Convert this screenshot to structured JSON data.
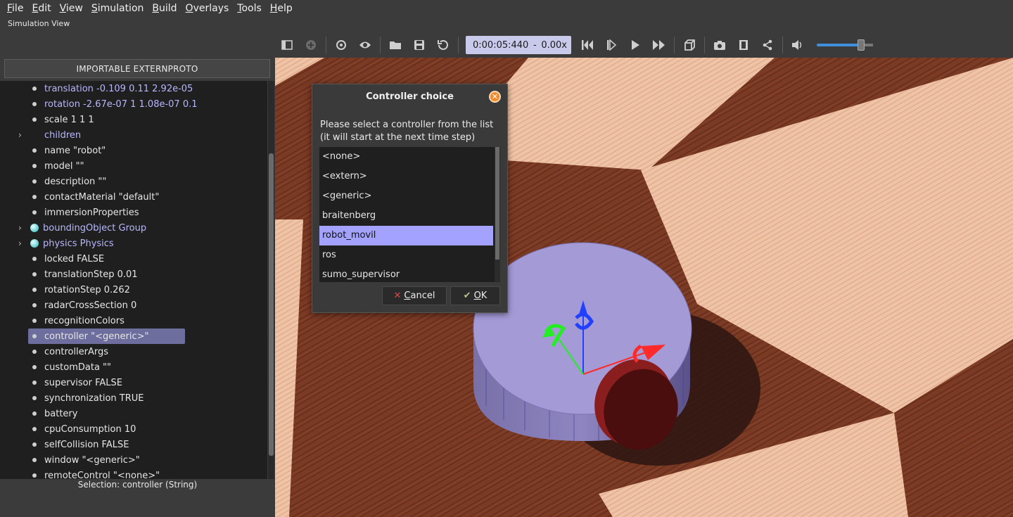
{
  "menubar": {
    "items": [
      {
        "label": "File",
        "u": "F",
        "rest": "ile"
      },
      {
        "label": "Edit",
        "u": "E",
        "rest": "dit"
      },
      {
        "label": "View",
        "u": "V",
        "rest": "iew"
      },
      {
        "label": "Simulation",
        "u": "S",
        "rest": "imulation"
      },
      {
        "label": "Build",
        "u": "B",
        "rest": "uild"
      },
      {
        "label": "Overlays",
        "u": "O",
        "rest": "verlays"
      },
      {
        "label": "Tools",
        "u": "T",
        "rest": "ools"
      },
      {
        "label": "Help",
        "u": "H",
        "rest": "elp"
      }
    ]
  },
  "window": {
    "subtitle": "Simulation View"
  },
  "toolbar": {
    "time": "0:00:05:440",
    "sep": "-",
    "speed": "0.00x",
    "volume_level": 0.85
  },
  "scene_tree": {
    "extern_button": "IMPORTABLE EXTERNPROTO",
    "status": "Selection: controller (String)",
    "rows": [
      {
        "text": "translation -0.109 0.11 2.92e-05",
        "style": "blue",
        "marker": "dot"
      },
      {
        "text": "rotation -2.67e-07 1 1.08e-07 0.1",
        "style": "blue",
        "marker": "dot"
      },
      {
        "text": "scale 1 1 1",
        "style": "",
        "marker": "dot"
      },
      {
        "text": "children",
        "style": "blue",
        "marker": "arrow"
      },
      {
        "text": "name \"robot\"",
        "style": "",
        "marker": "dot"
      },
      {
        "text": "model \"\"",
        "style": "",
        "marker": "dot"
      },
      {
        "text": "description \"\"",
        "style": "",
        "marker": "dot"
      },
      {
        "text": "contactMaterial \"default\"",
        "style": "",
        "marker": "dot"
      },
      {
        "text": "immersionProperties",
        "style": "",
        "marker": "dot"
      },
      {
        "text": "boundingObject Group",
        "style": "blue",
        "marker": "ball"
      },
      {
        "text": "physics Physics",
        "style": "blue",
        "marker": "ball"
      },
      {
        "text": "locked FALSE",
        "style": "",
        "marker": "dot"
      },
      {
        "text": "translationStep 0.01",
        "style": "",
        "marker": "dot"
      },
      {
        "text": "rotationStep 0.262",
        "style": "",
        "marker": "dot"
      },
      {
        "text": "radarCrossSection 0",
        "style": "",
        "marker": "dot"
      },
      {
        "text": "recognitionColors",
        "style": "",
        "marker": "dot"
      },
      {
        "text": "controller \"<generic>\"",
        "style": "",
        "marker": "dot",
        "selected": true
      },
      {
        "text": "controllerArgs",
        "style": "",
        "marker": "dot"
      },
      {
        "text": "customData \"\"",
        "style": "",
        "marker": "dot"
      },
      {
        "text": "supervisor FALSE",
        "style": "",
        "marker": "dot"
      },
      {
        "text": "synchronization TRUE",
        "style": "",
        "marker": "dot"
      },
      {
        "text": "battery",
        "style": "",
        "marker": "dot"
      },
      {
        "text": "cpuConsumption 10",
        "style": "",
        "marker": "dot"
      },
      {
        "text": "selfCollision FALSE",
        "style": "",
        "marker": "dot"
      },
      {
        "text": "window \"<generic>\"",
        "style": "",
        "marker": "dot"
      },
      {
        "text": "remoteControl \"<none>\"",
        "style": "",
        "marker": "dot"
      }
    ]
  },
  "dialog": {
    "title": "Controller choice",
    "message_line1": "Please select a controller from the list",
    "message_line2": "(it will start at the next time step)",
    "options": [
      "<none>",
      "<extern>",
      "<generic>",
      "braitenberg",
      "robot_movil",
      "ros",
      "sumo_supervisor"
    ],
    "selected": "robot_movil",
    "cancel_u": "C",
    "cancel_rest": "ancel",
    "ok_u": "O",
    "ok_rest": "K"
  }
}
